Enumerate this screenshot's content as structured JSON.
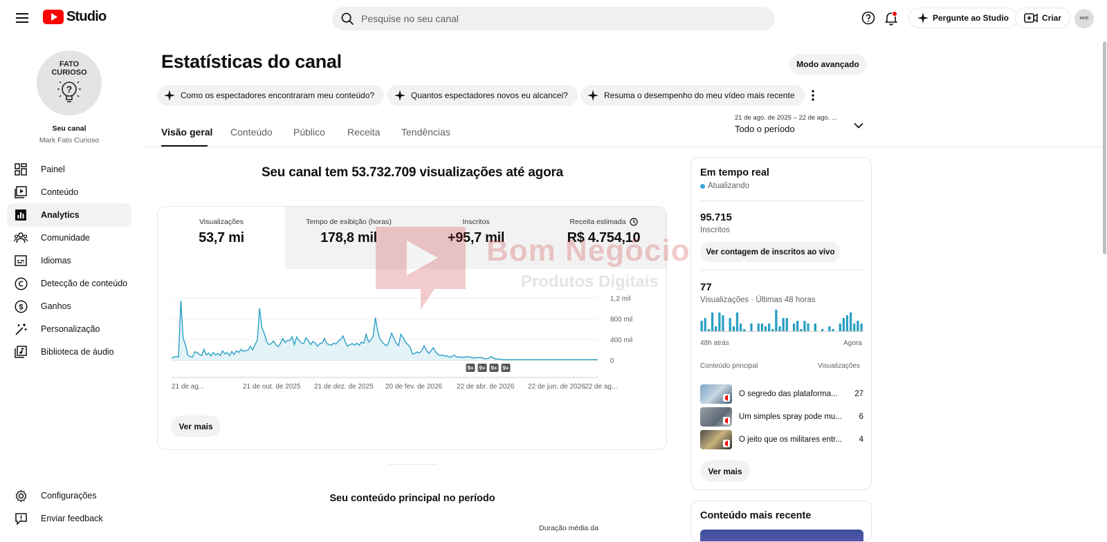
{
  "header": {
    "logo_text": "Studio",
    "search_placeholder": "Pesquise no seu canal",
    "ask_studio": "Pergunte ao Studio",
    "create": "Criar"
  },
  "sidebar": {
    "avatar_text_1": "FATO",
    "avatar_text_2": "CURIOSO",
    "channel_label": "Seu canal",
    "channel_name": "Mark Fato Curioso",
    "items": [
      {
        "label": "Painel",
        "icon": "dashboard-icon"
      },
      {
        "label": "Conteúdo",
        "icon": "content-icon"
      },
      {
        "label": "Analytics",
        "icon": "analytics-icon"
      },
      {
        "label": "Comunidade",
        "icon": "community-icon"
      },
      {
        "label": "Idiomas",
        "icon": "subtitles-icon"
      },
      {
        "label": "Detecção de conteúdo",
        "icon": "copyright-icon"
      },
      {
        "label": "Ganhos",
        "icon": "earn-icon"
      },
      {
        "label": "Personalização",
        "icon": "magic-wand-icon"
      },
      {
        "label": "Biblioteca de áudio",
        "icon": "audio-library-icon"
      }
    ],
    "bottom": [
      {
        "label": "Configurações",
        "icon": "settings-icon"
      },
      {
        "label": "Enviar feedback",
        "icon": "feedback-icon"
      }
    ]
  },
  "main": {
    "title": "Estatísticas do canal",
    "advanced_mode": "Modo avançado",
    "chips": [
      "Como os espectadores encontraram meu conteúdo?",
      "Quantos espectadores novos eu alcancei?",
      "Resuma o desempenho do meu vídeo mais recente"
    ],
    "tabs": [
      "Visão geral",
      "Conteúdo",
      "Público",
      "Receita",
      "Tendências"
    ],
    "date_range": "21 de ago. de 2025 – 22 de ago. ...",
    "period": "Todo o período",
    "heading": "Seu canal tem 53.732.709 visualizações até agora",
    "metrics": [
      {
        "label": "Visualizações",
        "value": "53,7 mi"
      },
      {
        "label": "Tempo de exibição (horas)",
        "value": "178,8 mil"
      },
      {
        "label": "Inscritos",
        "value": "+95,7 mil"
      },
      {
        "label": "Receita estimada",
        "value": "R$ 4.754,10"
      }
    ],
    "see_more": "Ver mais",
    "top_content_heading": "Seu conteúdo principal no período",
    "avg_duration_label": "Duração média da"
  },
  "chart_data": {
    "type": "area",
    "series": [
      {
        "values": [
          40,
          60,
          70,
          60,
          1150,
          420,
          300,
          100,
          70,
          60,
          160,
          150,
          110,
          90,
          210,
          100,
          140,
          80,
          150,
          100,
          130,
          90,
          180,
          120,
          150,
          90,
          170,
          110,
          180,
          150,
          210,
          170,
          190,
          190,
          270,
          200,
          300,
          380,
          1000,
          620,
          520,
          360,
          300,
          320,
          370,
          300,
          260,
          320,
          420,
          340,
          380,
          380,
          450,
          300,
          450,
          380,
          330,
          320,
          430,
          380,
          300,
          360,
          330,
          270,
          320,
          330,
          420,
          320,
          300,
          290,
          330,
          310,
          370,
          400,
          470,
          350,
          270,
          300,
          320,
          290,
          330,
          290,
          350,
          330,
          500,
          350,
          390,
          460,
          820,
          560,
          400,
          350,
          300,
          280,
          380,
          520,
          420,
          330,
          280,
          500,
          430,
          350,
          300,
          250,
          120,
          130,
          160,
          140,
          180,
          280,
          200,
          130,
          180,
          240,
          160,
          110,
          90,
          100,
          80,
          80,
          60,
          70,
          100,
          60,
          70,
          50,
          60,
          60,
          70,
          60,
          40,
          50,
          50,
          50,
          50,
          30,
          30,
          40,
          70,
          40,
          20,
          20,
          20,
          10,
          10,
          10,
          10,
          10,
          10,
          10,
          10,
          10,
          10,
          10,
          10,
          10,
          10,
          10,
          10,
          10,
          10,
          10,
          10,
          10,
          10,
          10,
          10,
          10,
          10,
          10,
          10,
          10,
          10,
          10,
          10,
          10,
          10,
          10,
          10,
          10,
          10,
          10,
          10,
          10,
          10
        ]
      }
    ],
    "x_tick_labels": [
      "21 de ag...",
      "21 de out. de 2025",
      "21 de dez. de 2025",
      "20 de fev. de 2026",
      "22 de abr. de 2026",
      "22 de jun. de 2026",
      "22 de ag..."
    ],
    "y_ticks": [
      "1,2 mil",
      "800 mil",
      "400 mil",
      "0"
    ],
    "ylim": [
      0,
      1200
    ],
    "event_markers": [
      "9+",
      "9+",
      "9+",
      "9+"
    ]
  },
  "realtime": {
    "title": "Em tempo real",
    "status": "Atualizando",
    "subscribers_value": "95.715",
    "subscribers_label": "Inscritos",
    "live_count_button": "Ver contagem de inscritos ao vivo",
    "views_value": "77",
    "views_label": "Visualizações · Últimas 48 horas",
    "bars": [
      4,
      5,
      1,
      7,
      2,
      7,
      6,
      0,
      5,
      2,
      7,
      3,
      1,
      0,
      3,
      0,
      3,
      3,
      2,
      3,
      1,
      8,
      2,
      5,
      5,
      0,
      3,
      4,
      1,
      4,
      3,
      0,
      3,
      0,
      1,
      0,
      2,
      1,
      0,
      3,
      5,
      6,
      7,
      3,
      4,
      3
    ],
    "axis_start": "48h atrás",
    "axis_end": "Agora",
    "table_header_left": "Conteúdo principal",
    "table_header_right": "Visualizações",
    "rows": [
      {
        "title": "O segredo das plataforma...",
        "views": "27"
      },
      {
        "title": "Um simples spray pode mu...",
        "views": "6"
      },
      {
        "title": "O jeito que os militares entr...",
        "views": "4"
      }
    ],
    "see_more": "Ver mais"
  },
  "latest": {
    "title": "Conteúdo mais recente"
  },
  "watermark": {
    "line1": "Bom Negócio",
    "line2": "Produtos Digitais"
  }
}
